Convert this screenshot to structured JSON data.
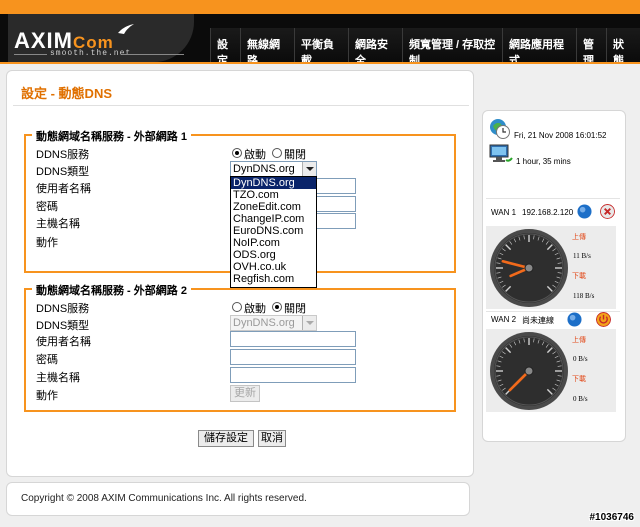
{
  "brand": {
    "name": "AXIM",
    "suffix": "Com",
    "tagline": "smooth.the.net"
  },
  "nav": {
    "items": [
      "設定",
      "無線網路",
      "平衡負載",
      "網路安全",
      "頻寬管理 / 存取控制",
      "網路應用程式",
      "管理",
      "狀態"
    ]
  },
  "page": {
    "title": "設定 - 動態DNS"
  },
  "group1": {
    "legend": "動態網域名稱服務 - 外部網路 1",
    "labels": {
      "service": "DDNS服務",
      "type": "DDNS類型",
      "username": "使用者名稱",
      "password": "密碼",
      "host": "主機名稱",
      "action": "動作"
    },
    "radio_on": "啟動",
    "radio_off": "關閉",
    "service_state": "on",
    "type_value": "DynDNS.org",
    "username_value": "",
    "password_value": "",
    "host_value": ""
  },
  "dropdown": {
    "options": [
      "DynDNS.org",
      "TZO.com",
      "ZoneEdit.com",
      "ChangeIP.com",
      "EuroDNS.com",
      "NoIP.com",
      "ODS.org",
      "OVH.co.uk",
      "Regfish.com"
    ],
    "selected": "DynDNS.org"
  },
  "group2": {
    "legend": "動態網域名稱服務 - 外部網路 2",
    "labels": {
      "service": "DDNS服務",
      "type": "DDNS類型",
      "username": "使用者名稱",
      "password": "密碼",
      "host": "主機名稱",
      "action": "動作"
    },
    "radio_on": "啟動",
    "radio_off": "關閉",
    "service_state": "off",
    "type_value": "DynDNS.org",
    "update_button": "更新"
  },
  "buttons": {
    "save": "儲存設定",
    "cancel": "取消"
  },
  "footer": {
    "copyright": "Copyright © 2008 AXIM Communications Inc. All rights reserved."
  },
  "status": {
    "datetime": "Fri, 21 Nov 2008 16:01:52",
    "uptime": "1 hour, 35 mins",
    "wan1": {
      "label": "WAN 1",
      "ip": "192.168.2.120",
      "up_label": "上傳",
      "up_value": "11 B/s",
      "down_label": "下載",
      "down_value": "118 B/s",
      "up_fraction": 0.08,
      "down_fraction": 0.22
    },
    "wan2": {
      "label": "WAN 2",
      "ip": "尚未連線",
      "up_label": "上傳",
      "up_value": "0 B/s",
      "down_label": "下載",
      "down_value": "0 B/s",
      "up_fraction": 0,
      "down_fraction": 0
    }
  },
  "watermark": "#1036746",
  "colors": {
    "accent": "#f7931e",
    "title": "#e07000",
    "selection": "#0a246a",
    "gauge_needle": "#f26a1b"
  }
}
